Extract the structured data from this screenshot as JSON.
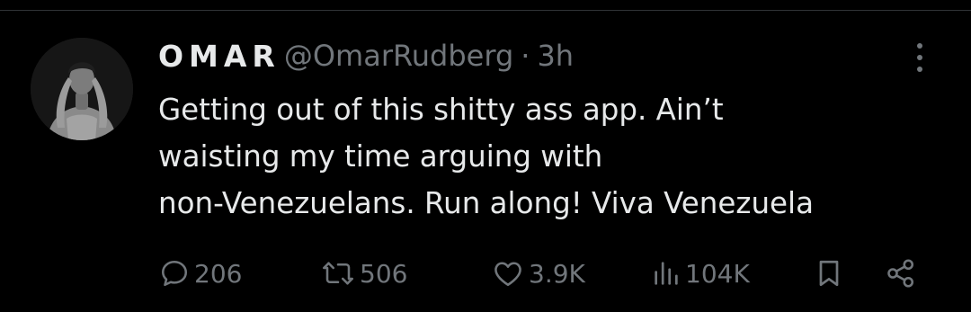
{
  "tweet": {
    "display_name": "OMAR",
    "handle": "@OmarRudberg",
    "separator": "·",
    "time": "3h",
    "text_lines": [
      "Getting out of this shitty ass app. Ain’t",
      "waisting my time arguing with",
      "non-Venezuelans. Run along! Viva Venezuela"
    ],
    "avatar_icon": "profile-photo",
    "more_icon": "more-vertical-icon"
  },
  "actions": {
    "reply_count": "206",
    "repost_count": "506",
    "like_count": "3.9K",
    "views_count": "104K",
    "icons": {
      "reply": "reply-icon",
      "repost": "repost-icon",
      "like": "heart-icon",
      "views": "views-icon",
      "bookmark": "bookmark-icon",
      "share": "share-icon"
    }
  },
  "colors": {
    "background": "#000000",
    "text_primary": "#e7e9ea",
    "text_secondary": "#71767b",
    "divider": "#2f3336"
  }
}
